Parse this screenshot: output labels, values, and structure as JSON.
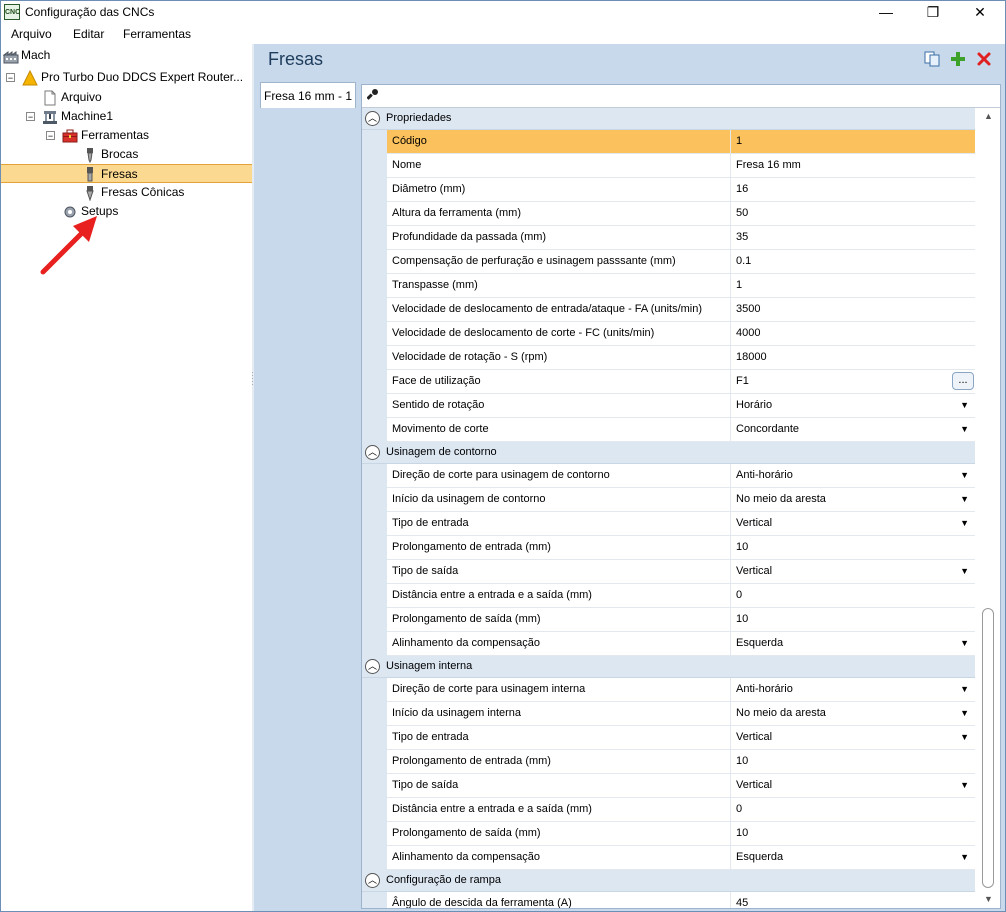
{
  "window": {
    "title": "Configuração das CNCs",
    "app_icon_text": "CNC",
    "controls": {
      "minimize": "—",
      "maximize": "❐",
      "close": "✕"
    }
  },
  "menu": [
    "Arquivo",
    "Editar",
    "Ferramentas"
  ],
  "tree": {
    "root": "Mach",
    "machine_family": "Pro Turbo Duo DDCS Expert Router...",
    "arquivo": "Arquivo",
    "machine": "Machine1",
    "ferramentas": "Ferramentas",
    "brocas": "Brocas",
    "fresas": "Fresas",
    "fresas_conicas": "Fresas Cônicas",
    "setups": "Setups"
  },
  "panel": {
    "title": "Fresas",
    "tab": "Fresa 16 mm - 1"
  },
  "groups": {
    "propriedades": {
      "label": "Propriedades",
      "rows": [
        {
          "name": "Código",
          "value": "1"
        },
        {
          "name": "Nome",
          "value": "Fresa 16 mm"
        },
        {
          "name": "Diâmetro (mm)",
          "value": "16"
        },
        {
          "name": "Altura da ferramenta (mm)",
          "value": "50"
        },
        {
          "name": "Profundidade da passada (mm)",
          "value": "35"
        },
        {
          "name": "Compensação de perfuração e usinagem passsante (mm)",
          "value": "0.1"
        },
        {
          "name": "Transpasse (mm)",
          "value": "1"
        },
        {
          "name": "Velocidade de deslocamento de entrada/ataque - FA (units/min)",
          "value": "3500"
        },
        {
          "name": "Velocidade de deslocamento de corte - FC (units/min)",
          "value": "4000"
        },
        {
          "name": "Velocidade de rotação - S (rpm)",
          "value": "18000"
        },
        {
          "name": "Face de utilização",
          "value": "F1",
          "button": "..."
        },
        {
          "name": "Sentido de rotação",
          "value": "Horário"
        },
        {
          "name": "Movimento de corte",
          "value": "Concordante"
        }
      ]
    },
    "contorno": {
      "label": "Usinagem de contorno",
      "rows": [
        {
          "name": "Direção de corte para usinagem de contorno",
          "value": "Anti-horário"
        },
        {
          "name": "Início da usinagem de contorno",
          "value": "No meio da aresta"
        },
        {
          "name": "Tipo de entrada",
          "value": "Vertical"
        },
        {
          "name": "Prolongamento de entrada (mm)",
          "value": "10"
        },
        {
          "name": "Tipo de saída",
          "value": "Vertical"
        },
        {
          "name": "Distância entre a entrada e a saída (mm)",
          "value": "0"
        },
        {
          "name": "Prolongamento de saída (mm)",
          "value": "10"
        },
        {
          "name": "Alinhamento da compensação",
          "value": "Esquerda"
        }
      ]
    },
    "interna": {
      "label": "Usinagem interna",
      "rows": [
        {
          "name": "Direção de corte para usinagem interna",
          "value": "Anti-horário"
        },
        {
          "name": "Início da usinagem interna",
          "value": "No meio da aresta"
        },
        {
          "name": "Tipo de entrada",
          "value": "Vertical"
        },
        {
          "name": "Prolongamento de entrada (mm)",
          "value": "10"
        },
        {
          "name": "Tipo de saída",
          "value": "Vertical"
        },
        {
          "name": "Distância entre a entrada e a saída (mm)",
          "value": "0"
        },
        {
          "name": "Prolongamento de saída (mm)",
          "value": "10"
        },
        {
          "name": "Alinhamento da compensação",
          "value": "Esquerda"
        }
      ]
    },
    "rampa": {
      "label": "Configuração de rampa",
      "rows": [
        {
          "name": "Ângulo de descida da ferramenta (A)",
          "value": "45"
        }
      ]
    }
  },
  "colors": {
    "selection": "#fbc15c",
    "panel_bg": "#c9d9ec",
    "category_bg": "#dde7f2",
    "annotation_arrow": "#e8201f"
  },
  "icons": {
    "copy": "copy-icon",
    "add": "add-icon",
    "delete": "delete-icon",
    "wrench": "wrench-icon"
  }
}
